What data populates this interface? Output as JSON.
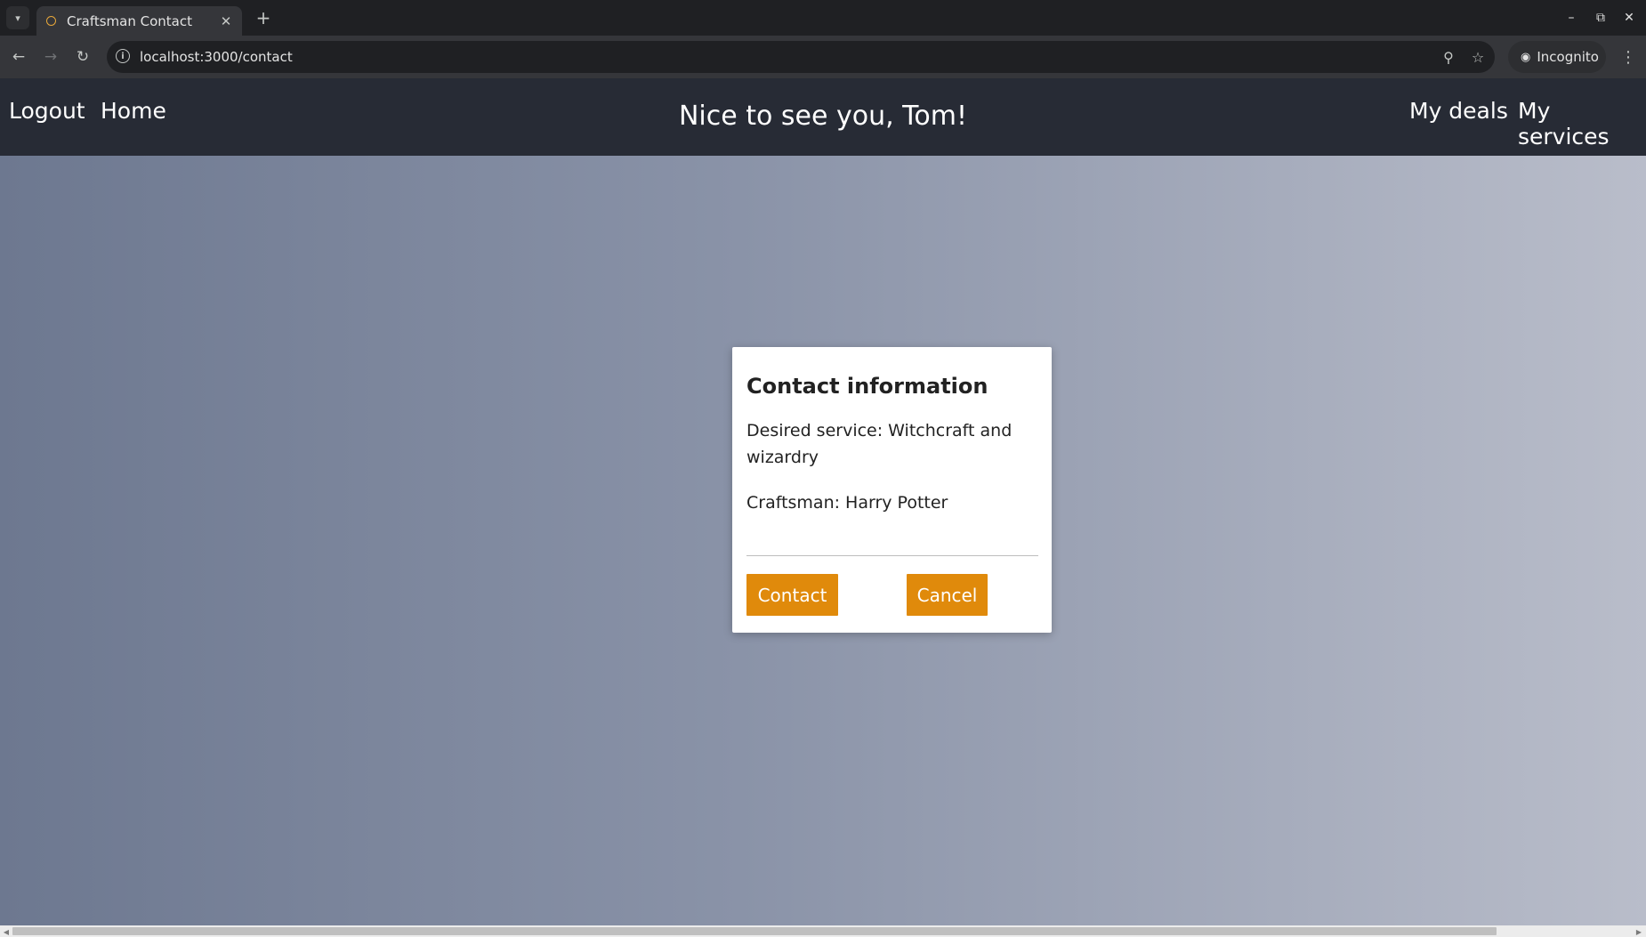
{
  "browser": {
    "tab_title": "Craftsman Contact",
    "url": "localhost:3000/contact",
    "incognito_label": "Incognito"
  },
  "nav": {
    "logout": "Logout",
    "home": "Home",
    "greeting": "Nice to see you, Tom!",
    "my_deals": "My deals",
    "my_services": "My services"
  },
  "dialog": {
    "title": "Contact information",
    "service": "Desired service: Witchcraft and wizardry",
    "craftsman": "Craftsman: Harry Potter",
    "contact_label": "Contact",
    "cancel_label": "Cancel"
  },
  "colors": {
    "accent": "#e08a0b",
    "navbar": "#272b35"
  }
}
